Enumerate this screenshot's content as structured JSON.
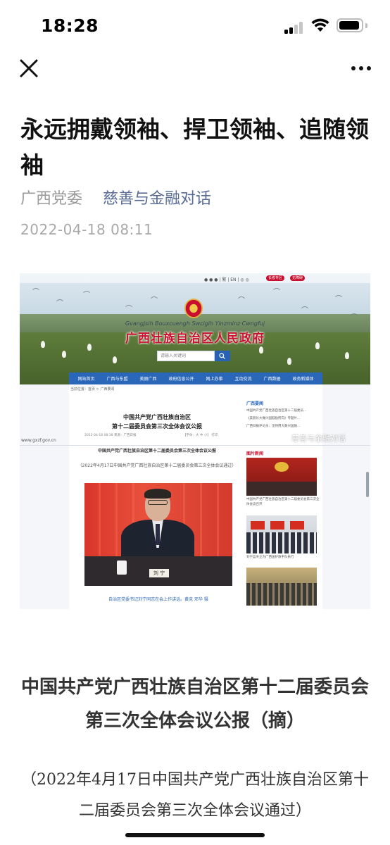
{
  "status_bar": {
    "time": "18:28"
  },
  "nav": {
    "close_icon": "close-icon",
    "more_icon": "more-icon"
  },
  "article": {
    "title": "永远拥戴领袖、捍卫领袖、追随领袖",
    "author": "广西党委",
    "account_name": "慈善与金融对话",
    "publish_time": "2022-04-18 08:11",
    "body_heading": "中国共产党广西壮族自治区第十二届委员会第三次全体会议公报（摘）",
    "body_subheading": "（2022年4月17日中国共产党广西壮族自治区第十二届委员会第三次全体会议通过）"
  },
  "embedded_screenshot": {
    "site_name_en": "Gvangjsih Bouxcuengh Swcigih Yinzminz Cwngfuj",
    "site_name": "广西壮族自治区人民政府",
    "search_placeholder": "请输入关键词",
    "nav_items": [
      "网站首页",
      "广西与东盟",
      "美丽广西",
      "政府信息公开",
      "网上办事",
      "互动交流",
      "广西数据",
      "政务新媒体"
    ],
    "breadcrumb": "当前位置：首页 > 广西要闻",
    "doc_title": "中国共产党广西壮族自治区\n第十二届委员会第三次全体会议公报",
    "doc_date": "2022-04-18 08:38   来源：广西日报",
    "doc_controls": "【字体：大 中 小】  打印",
    "site_url": "www.gxzf.gov.cn",
    "right_head": "广西要闻",
    "right_items": [
      "中国共产党广西壮族自治区第十二届委员...",
      "《美丽长大做兴国鼓励所向》专题片...",
      "广西日报评论员：坚持用大数兴国鼓..."
    ],
    "watermark": "慈善与金融对话",
    "doc2_title": "中国共产党广西壮族自治区第十二届委员会第三次全体会议公报",
    "doc2_subtitle": "（2022年4月17日中国共产党广西壮族自治区第十二届委员会第三次全体会议通过）",
    "nameplate": "刘 宁",
    "photo_caption": "自治区党委书记刘宁同志在会上作讲话。黄克 邓华 摄",
    "pic_news_head": "图片新闻",
    "thumb_caption_1": "中国共产党广西壮族自治区第十二届委员会第三次全体会议召开",
    "thumb_caption_2": "刘宁蓝天立为广西国护旗手队执行"
  },
  "colors": {
    "link_blue": "#576b95",
    "gov_red": "#c8102e",
    "gov_blue": "#2a67b9"
  }
}
